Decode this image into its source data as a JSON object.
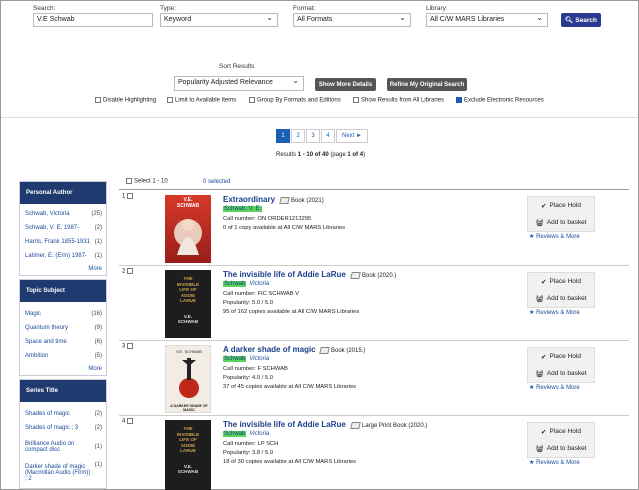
{
  "search": {
    "search_label": "Search:",
    "search_value": "V.E Schwab",
    "type_label": "Type:",
    "type_value": "Keyword",
    "format_label": "Format:",
    "format_value": "All Formats",
    "library_label": "Library:",
    "library_value": "All C/W MARS Libraries",
    "search_button": "Search"
  },
  "sort": {
    "label": "Sort Results",
    "value": "Popularity Adjusted Relevance",
    "show_more": "Show More Details",
    "refine": "Refine My Original Search"
  },
  "options": [
    {
      "label": "Disable Highlighting",
      "checked": false
    },
    {
      "label": "Limit to Available Items",
      "checked": false
    },
    {
      "label": "Group By Formats and Editions",
      "checked": false
    },
    {
      "label": "Show Results from All Libraries",
      "checked": false
    },
    {
      "label": "Exclude Electronic Resources",
      "checked": true
    }
  ],
  "pagination": {
    "pages": [
      "1",
      "2",
      "3",
      "4"
    ],
    "next": "Next ►",
    "summary_prefix": "Results ",
    "summary_range": "1 - 10 of 40",
    "summary_mid": " (page ",
    "summary_page": "1 of 4",
    "summary_end": ")"
  },
  "select_bar": {
    "select_label": "Select 1 - 10",
    "selected": "0 selected"
  },
  "facets": [
    {
      "title": "Personal Author",
      "items": [
        {
          "label": "Schwab, Victoria",
          "count": "(25)"
        },
        {
          "label": "Schwab, V. E. 1987-",
          "count": "(2)"
        },
        {
          "label": "Harris, Frank 1855-1931",
          "count": "(1)"
        },
        {
          "label": "Latimer, E. (Erin) 1987-",
          "count": "(1)"
        }
      ],
      "more": "More"
    },
    {
      "title": "Topic Subject",
      "items": [
        {
          "label": "Magic",
          "count": "(16)"
        },
        {
          "label": "Quantum theory",
          "count": "(9)"
        },
        {
          "label": "Space and time",
          "count": "(6)"
        },
        {
          "label": "Ambition",
          "count": "(5)"
        }
      ],
      "more": "More"
    },
    {
      "title": "Series Title",
      "items": [
        {
          "label": "Shades of magic",
          "count": "(2)"
        },
        {
          "label": "Shades of magic ; 3",
          "count": "(2)"
        },
        {
          "label": "Brilliance Audio on",
          "label2": "compact disc",
          "count": "(1)"
        },
        {
          "label": "Darker shade of magic",
          "label2": "(Macmillan Audio (Firm))",
          "label3": "; 2",
          "count": "(1)"
        }
      ]
    }
  ],
  "results": [
    {
      "num": "1",
      "title": "Extraordinary",
      "format": "Book (2021)",
      "author_hl": "Schwab, V. E.",
      "author_rest": "",
      "lines": [
        "Call number: ON ORDER1213295",
        "0 of 1 copy available at All C/W MARS Libraries"
      ],
      "cover_text": [
        "V.E.",
        "SCHWAB"
      ]
    },
    {
      "num": "2",
      "title": "The invisible life of Addie LaRue",
      "format": "Book (2020.)",
      "author_hl": "Schwab",
      "author_rest": "Victoria",
      "lines": [
        "Call number: FIC SCHWAB V",
        "Popularity: 5.0 / 5.0",
        "95 of 162 copies available at All C/W MARS Libraries"
      ],
      "cover_text": [
        "THE",
        "INVISIBLE",
        "LIFE OF",
        "ADDIE",
        "LARUE",
        "V.E.",
        "SCHWAB"
      ]
    },
    {
      "num": "3",
      "title": "A darker shade of magic",
      "format": "Book (2015.)",
      "author_hl": "Schwab",
      "author_rest": "Victoria",
      "lines": [
        "Call number: F SCHWAB",
        "Popularity: 4.0 / 5.0",
        "37 of 45 copies available at All C/W MARS Libraries"
      ],
      "cover_text": [
        "V.E. SCHWAB",
        "A DARKER SHADE OF MAGIC"
      ]
    },
    {
      "num": "4",
      "title": "The invisible life of Addie LaRue",
      "format": "Large Print Book (2020.)",
      "author_hl": "Schwab",
      "author_rest": "Victoria",
      "lines": [
        "Call number: LP SCH",
        "Popularity: 3.8 / 5.0",
        "18 of 30 copies available at All C/W MARS Libraries"
      ],
      "cover_text": [
        "THE",
        "INVISIBLE",
        "LIFE OF",
        "ADDIE",
        "LARUE",
        "V.E.",
        "SCHWAB"
      ]
    }
  ],
  "actions": {
    "place_hold": "Place Hold",
    "add_basket": "Add to basket",
    "reviews": "Reviews & More"
  },
  "colors": {
    "primary": "#2a3b8f",
    "facet_header": "#1f3a6e",
    "link": "#1a4b9a",
    "highlight": "#5ad45a"
  }
}
